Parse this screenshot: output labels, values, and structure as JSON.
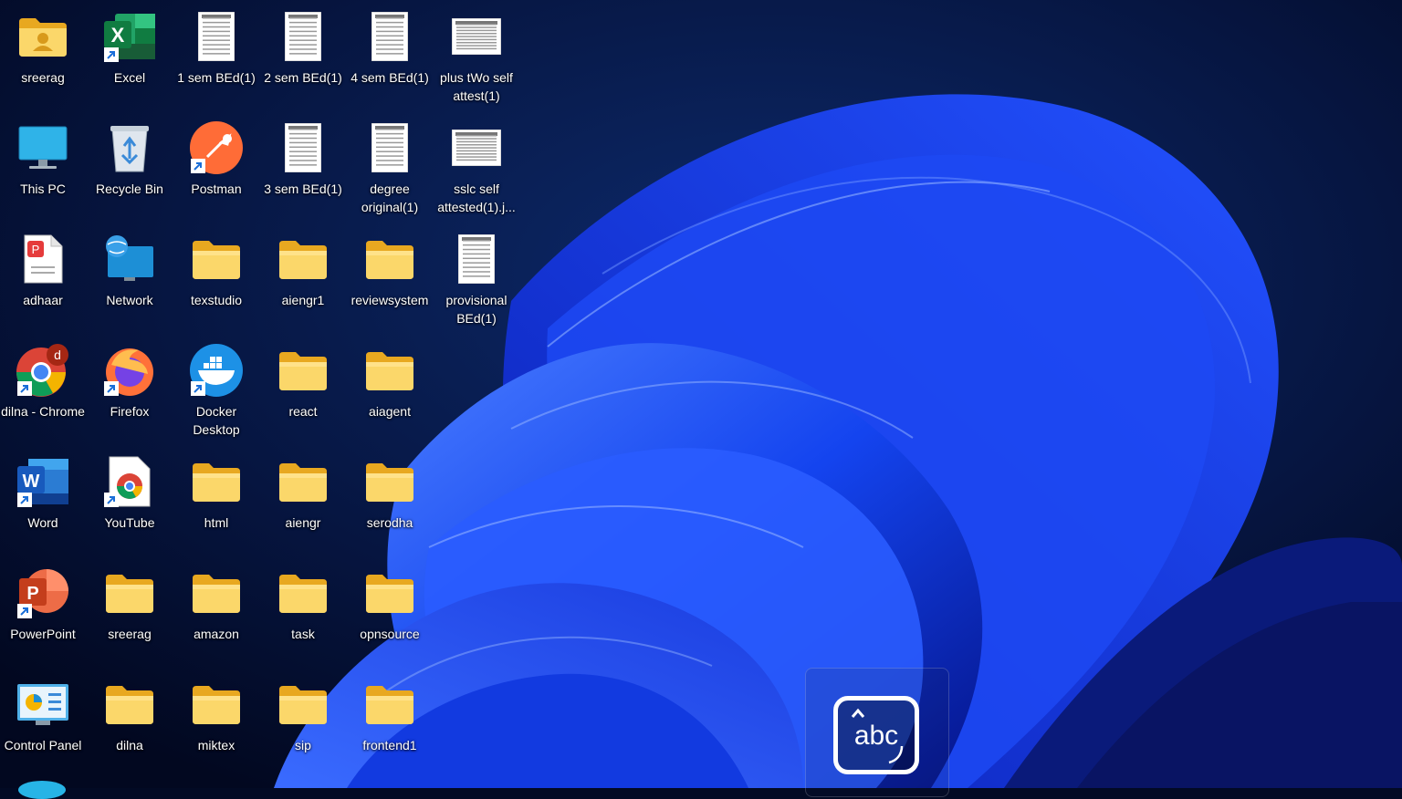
{
  "desktop": {
    "icons": [
      {
        "label": "sreerag",
        "icon": "user-folder-icon"
      },
      {
        "label": "Excel",
        "icon": "excel-icon"
      },
      {
        "label": "1 sem BEd(1)",
        "icon": "document-thumbnail-icon"
      },
      {
        "label": "2 sem BEd(1)",
        "icon": "document-thumbnail-icon"
      },
      {
        "label": "4 sem BEd(1)",
        "icon": "document-thumbnail-icon"
      },
      {
        "label": "plus tWo self attest(1)",
        "icon": "document-thumbnail-icon"
      },
      {
        "label": "This PC",
        "icon": "monitor-icon"
      },
      {
        "label": "Recycle Bin",
        "icon": "recycle-bin-icon"
      },
      {
        "label": "Postman",
        "icon": "postman-icon"
      },
      {
        "label": "3 sem BEd(1)",
        "icon": "document-thumbnail-icon"
      },
      {
        "label": "degree original(1)",
        "icon": "document-thumbnail-icon"
      },
      {
        "label": "sslc self attested(1).j...",
        "icon": "document-thumbnail-icon"
      },
      {
        "label": "adhaar",
        "icon": "pdf-file-icon"
      },
      {
        "label": "Network",
        "icon": "network-icon"
      },
      {
        "label": "texstudio",
        "icon": "folder-icon"
      },
      {
        "label": "aiengr1",
        "icon": "folder-icon"
      },
      {
        "label": "reviewsystem",
        "icon": "folder-icon"
      },
      {
        "label": "provisional BEd(1)",
        "icon": "document-thumbnail-icon"
      },
      {
        "label": "dilna - Chrome",
        "icon": "chrome-profile-icon",
        "badge": "d"
      },
      {
        "label": "Firefox",
        "icon": "firefox-icon"
      },
      {
        "label": "Docker Desktop",
        "icon": "docker-icon"
      },
      {
        "label": "react",
        "icon": "folder-icon"
      },
      {
        "label": "aiagent",
        "icon": "folder-icon"
      },
      {
        "label": "Word",
        "icon": "word-icon"
      },
      {
        "label": "YouTube",
        "icon": "chrome-app-icon"
      },
      {
        "label": "html",
        "icon": "folder-icon"
      },
      {
        "label": "aiengr",
        "icon": "folder-icon"
      },
      {
        "label": "serodha",
        "icon": "folder-icon"
      },
      {
        "label": "PowerPoint",
        "icon": "powerpoint-icon"
      },
      {
        "label": "sreerag",
        "icon": "folder-icon"
      },
      {
        "label": "amazon",
        "icon": "folder-icon"
      },
      {
        "label": "task",
        "icon": "folder-icon"
      },
      {
        "label": "opnsource",
        "icon": "folder-icon"
      },
      {
        "label": "Control Panel",
        "icon": "control-panel-icon"
      },
      {
        "label": "dilna",
        "icon": "folder-icon"
      },
      {
        "label": "miktex",
        "icon": "folder-icon"
      },
      {
        "label": "sip",
        "icon": "folder-icon"
      },
      {
        "label": "frontend1",
        "icon": "folder-icon"
      }
    ]
  },
  "ime_indicator": {
    "text": "abc",
    "icon": "keyboard-ime-icon"
  },
  "colors": {
    "background": "#020a24",
    "bloom": "#1b4dff",
    "folder": "#f7c948"
  }
}
